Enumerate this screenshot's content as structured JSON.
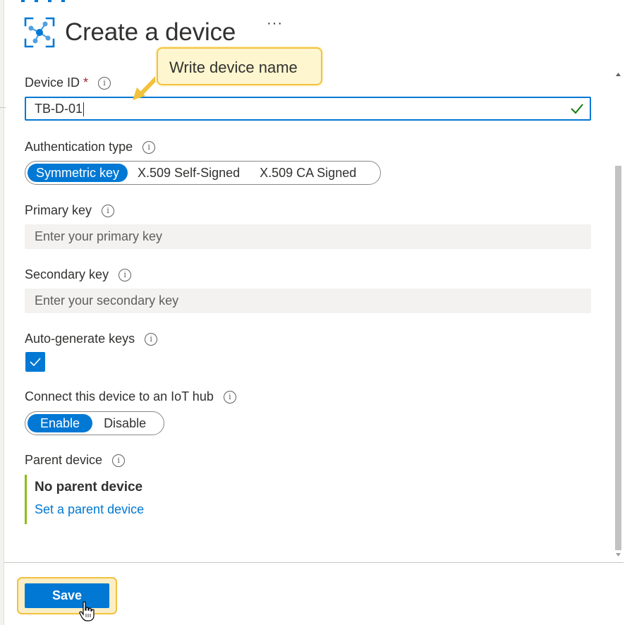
{
  "header": {
    "title": "Create a device",
    "more_label": "···"
  },
  "callout": {
    "text": "Write device name"
  },
  "device_id": {
    "label": "Device ID",
    "required_mark": "*",
    "value": "TB-D-01"
  },
  "auth_type": {
    "label": "Authentication type",
    "options": [
      "Symmetric key",
      "X.509 Self-Signed",
      "X.509 CA Signed"
    ],
    "selected": "Symmetric key"
  },
  "primary_key": {
    "label": "Primary key",
    "placeholder": "Enter your primary key"
  },
  "secondary_key": {
    "label": "Secondary key",
    "placeholder": "Enter your secondary key"
  },
  "auto_generate": {
    "label": "Auto-generate keys",
    "checked": true
  },
  "connect_hub": {
    "label": "Connect this device to an IoT hub",
    "options": [
      "Enable",
      "Disable"
    ],
    "selected": "Enable"
  },
  "parent_device": {
    "label": "Parent device",
    "value": "No parent device",
    "link": "Set a parent device"
  },
  "footer": {
    "save_label": "Save"
  },
  "colors": {
    "accent": "#0078d4",
    "callout_border": "#f2c23e",
    "callout_fill": "#fef6cf",
    "parent_bar": "#8cbd18",
    "valid_check": "#107c10"
  },
  "icons": {
    "logo": "iot-device-icon",
    "info": "info-icon",
    "valid": "checkmark-icon",
    "cursor": "hand-pointer-icon"
  }
}
